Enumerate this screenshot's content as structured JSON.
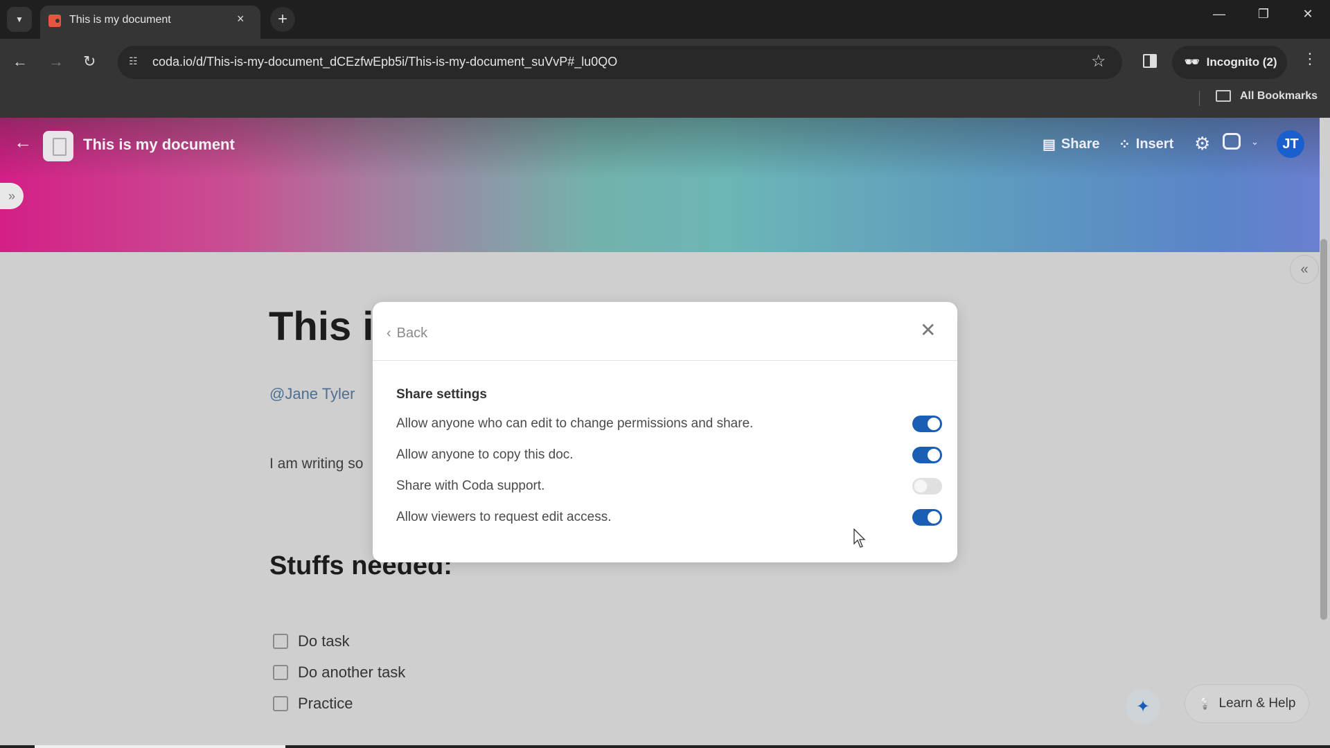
{
  "browser": {
    "tab_title": "This is my document",
    "url": "coda.io/d/This-is-my-document_dCEzfwEpb5i/This-is-my-document_suVvP#_lu0QO",
    "profile_label": "Incognito (2)",
    "bookmarks_label": "All Bookmarks"
  },
  "doc_header": {
    "title": "This is my document",
    "share_label": "Share",
    "insert_label": "Insert",
    "avatar_initials": "JT",
    "avatar_color": "#1a5fce"
  },
  "page": {
    "title_visible": "This is",
    "mention": "@Jane Tyler",
    "paragraph_visible": "I am writing so",
    "section_heading": "Stuffs needed:",
    "tasks": [
      {
        "label": "Do task",
        "checked": false
      },
      {
        "label": "Do another task",
        "checked": false
      },
      {
        "label": "Practice",
        "checked": false
      }
    ]
  },
  "modal": {
    "back_label": "Back",
    "heading": "Share settings",
    "settings": [
      {
        "label": "Allow anyone who can edit to change permissions and share.",
        "enabled": true
      },
      {
        "label": "Allow anyone to copy this doc.",
        "enabled": true
      },
      {
        "label": "Share with Coda support.",
        "enabled": false
      },
      {
        "label": "Allow viewers to request edit access.",
        "enabled": true
      }
    ],
    "toggle_on_color": "#1b5fb5"
  },
  "footer": {
    "help_label": "Learn & Help"
  },
  "icons": {
    "tab_close": "×",
    "new_tab": "+",
    "back": "←",
    "forward": "→",
    "reload": "↻",
    "star": "☆",
    "menu": "⋮",
    "minimize": "—",
    "restore": "❐",
    "close": "✕",
    "chev_down": "⌄",
    "expand": "»",
    "collapse": "«",
    "gear": "⚙",
    "sparkle": "✦",
    "bulb": "💡",
    "chevron_left": "‹"
  }
}
